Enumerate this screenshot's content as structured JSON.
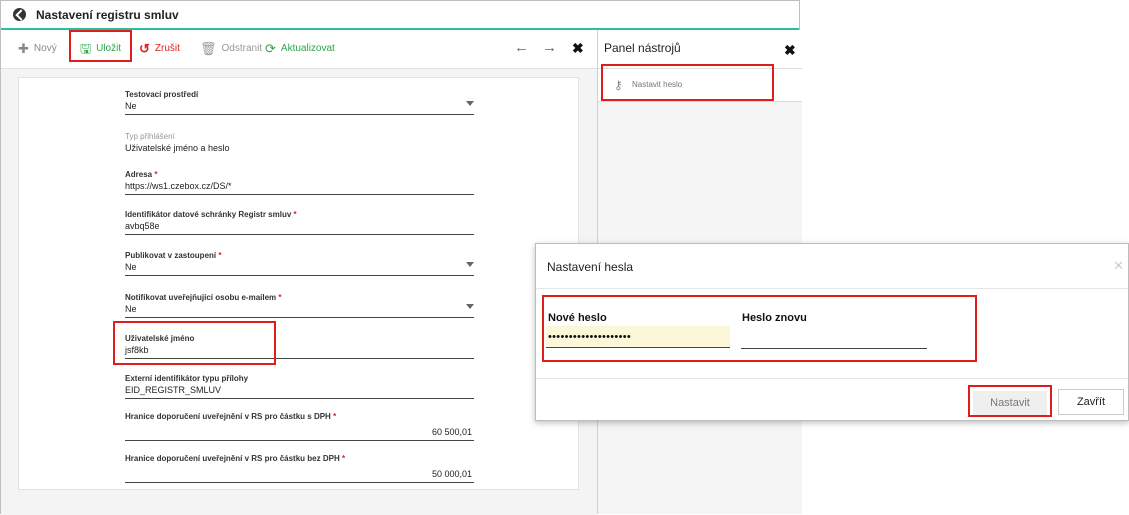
{
  "window": {
    "title": "Nastavení registru smluv"
  },
  "toolbar": {
    "new_label": "Nový",
    "save_label": "Uložit",
    "cancel_label": "Zrušit",
    "delete_label": "Odstranit",
    "refresh_label": "Aktualizovat"
  },
  "form": {
    "test_env": {
      "label": "Testovací prostředí",
      "value": "Ne"
    },
    "login_type": {
      "label": "Typ přihlášení",
      "value": "Uživatelské jméno a heslo"
    },
    "address": {
      "label": "Adresa",
      "value": "https://ws1.czebox.cz/DS/*"
    },
    "databox_id": {
      "label": "Identifikátor datové schránky Registr smluv",
      "value": "avbq58e"
    },
    "publish_repr": {
      "label": "Publikovat v zastoupení",
      "value": "Ne"
    },
    "notify_email": {
      "label": "Notifikovat uveřejňující osobu e-mailem",
      "value": "Ne"
    },
    "username": {
      "label": "Uživatelské jméno",
      "value": "jsf8kb"
    },
    "ext_attach_id": {
      "label": "Externí identifikátor typu přílohy",
      "value": "EID_REGISTR_SMLUV"
    },
    "limit_vat": {
      "label": "Hranice doporučení uveřejnění v RS pro částku s DPH",
      "value": "60 500,01"
    },
    "limit_novat": {
      "label": "Hranice doporučení uveřejnění v RS pro částku bez DPH",
      "value": "50 000,01"
    },
    "required_mark": "*"
  },
  "panel": {
    "title": "Panel nástrojů",
    "item_set_password": "Nastavit heslo"
  },
  "dialog": {
    "title": "Nastavení hesla",
    "new_password_label": "Nové heslo",
    "new_password_value": "••••••••••••••••••••",
    "repeat_password_label": "Heslo znovu",
    "repeat_password_value": "",
    "set_button": "Nastavit",
    "close_button": "Zavřít"
  },
  "colors": {
    "accent": "#2bbfa0",
    "highlight": "#e01c1c",
    "save_green": "#2aa84a",
    "cancel_red": "#d22222"
  }
}
